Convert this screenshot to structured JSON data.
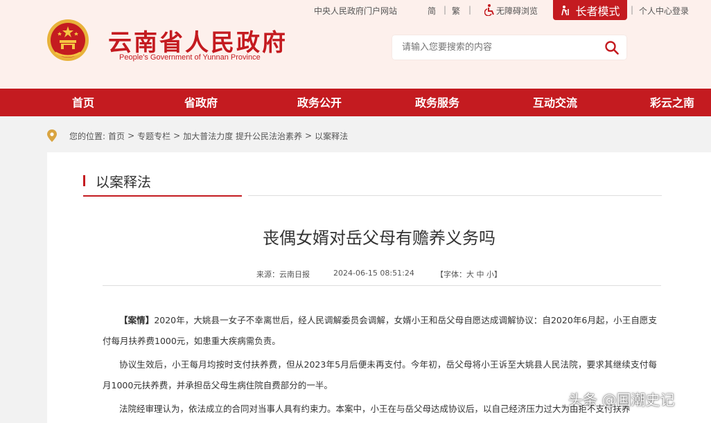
{
  "header": {
    "site_title": "云南省人民政府",
    "site_subtitle": "People's Government of Yunnan Province",
    "top_links": {
      "central_portal": "中央人民政府门户网站",
      "simplified": "简",
      "traditional": "繁",
      "accessibility": "无障碍浏览",
      "elder_mode": "长者模式",
      "user_center": "个人中心登录"
    },
    "search": {
      "placeholder": "请输入您要搜索的内容"
    }
  },
  "nav": {
    "items": [
      "首页",
      "省政府",
      "政务公开",
      "政务服务",
      "互动交流",
      "彩云之南"
    ]
  },
  "breadcrumb": {
    "prefix": "您的位置:",
    "items": [
      "首页",
      "专题专栏",
      "加大普法力度 提升公民法治素养",
      "以案释法"
    ],
    "separator": ">"
  },
  "section": {
    "title": "以案释法"
  },
  "article": {
    "title": "丧偶女婿对岳父母有赡养义务吗",
    "source": "来源：云南日报",
    "date": "2024-06-15 08:51:24",
    "font_size": "【字体：大 中 小】",
    "paragraphs": [
      {
        "tag": "【案情】",
        "text": "2020年，大姚县一女子不幸离世后，经人民调解委员会调解，女婿小王和岳父母自愿达成调解协议：自2020年6月起，小王自愿支付每月扶养费1000元，如患重大疾病需负责。"
      },
      {
        "tag": "",
        "text": "协议生效后，小王每月均按时支付扶养费，但从2023年5月后便未再支付。今年初，岳父母将小王诉至大姚县人民法院，要求其继续支付每月1000元扶养费，并承担岳父母生病住院自费部分的一半。"
      },
      {
        "tag": "",
        "text": "法院经审理认为，依法成立的合同对当事人具有约束力。本案中，小王在与岳父母达成协议后，以自己经济压力过大为由拒不支付扶养"
      }
    ]
  },
  "watermark": "头条 @国潮史记",
  "colors": {
    "brand_red": "#c41b20",
    "header_bg": "#fdf0ec"
  }
}
